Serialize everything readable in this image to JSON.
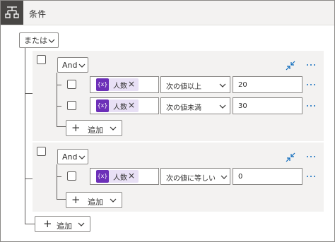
{
  "header": {
    "title": "条件",
    "icon": "condition-icon"
  },
  "root": {
    "operator_label": "または",
    "add_label": "追加"
  },
  "groups": [
    {
      "operator_label": "And",
      "add_label": "追加",
      "rows": [
        {
          "token_icon_text": "{x}",
          "token_label": "人数",
          "operator": "次の値以上",
          "value": "20"
        },
        {
          "token_icon_text": "{x}",
          "token_label": "人数",
          "operator": "次の値未満",
          "value": "30"
        }
      ]
    },
    {
      "operator_label": "And",
      "add_label": "追加",
      "rows": [
        {
          "token_icon_text": "{x}",
          "token_label": "人数",
          "operator": "次の値に等しい",
          "value": "0"
        }
      ]
    }
  ],
  "colors": {
    "accent": "#0f6cbd",
    "token_bg": "#e8e0f5",
    "token_icon": "#6c2fb8",
    "group_bg": "#f3f2f1"
  }
}
